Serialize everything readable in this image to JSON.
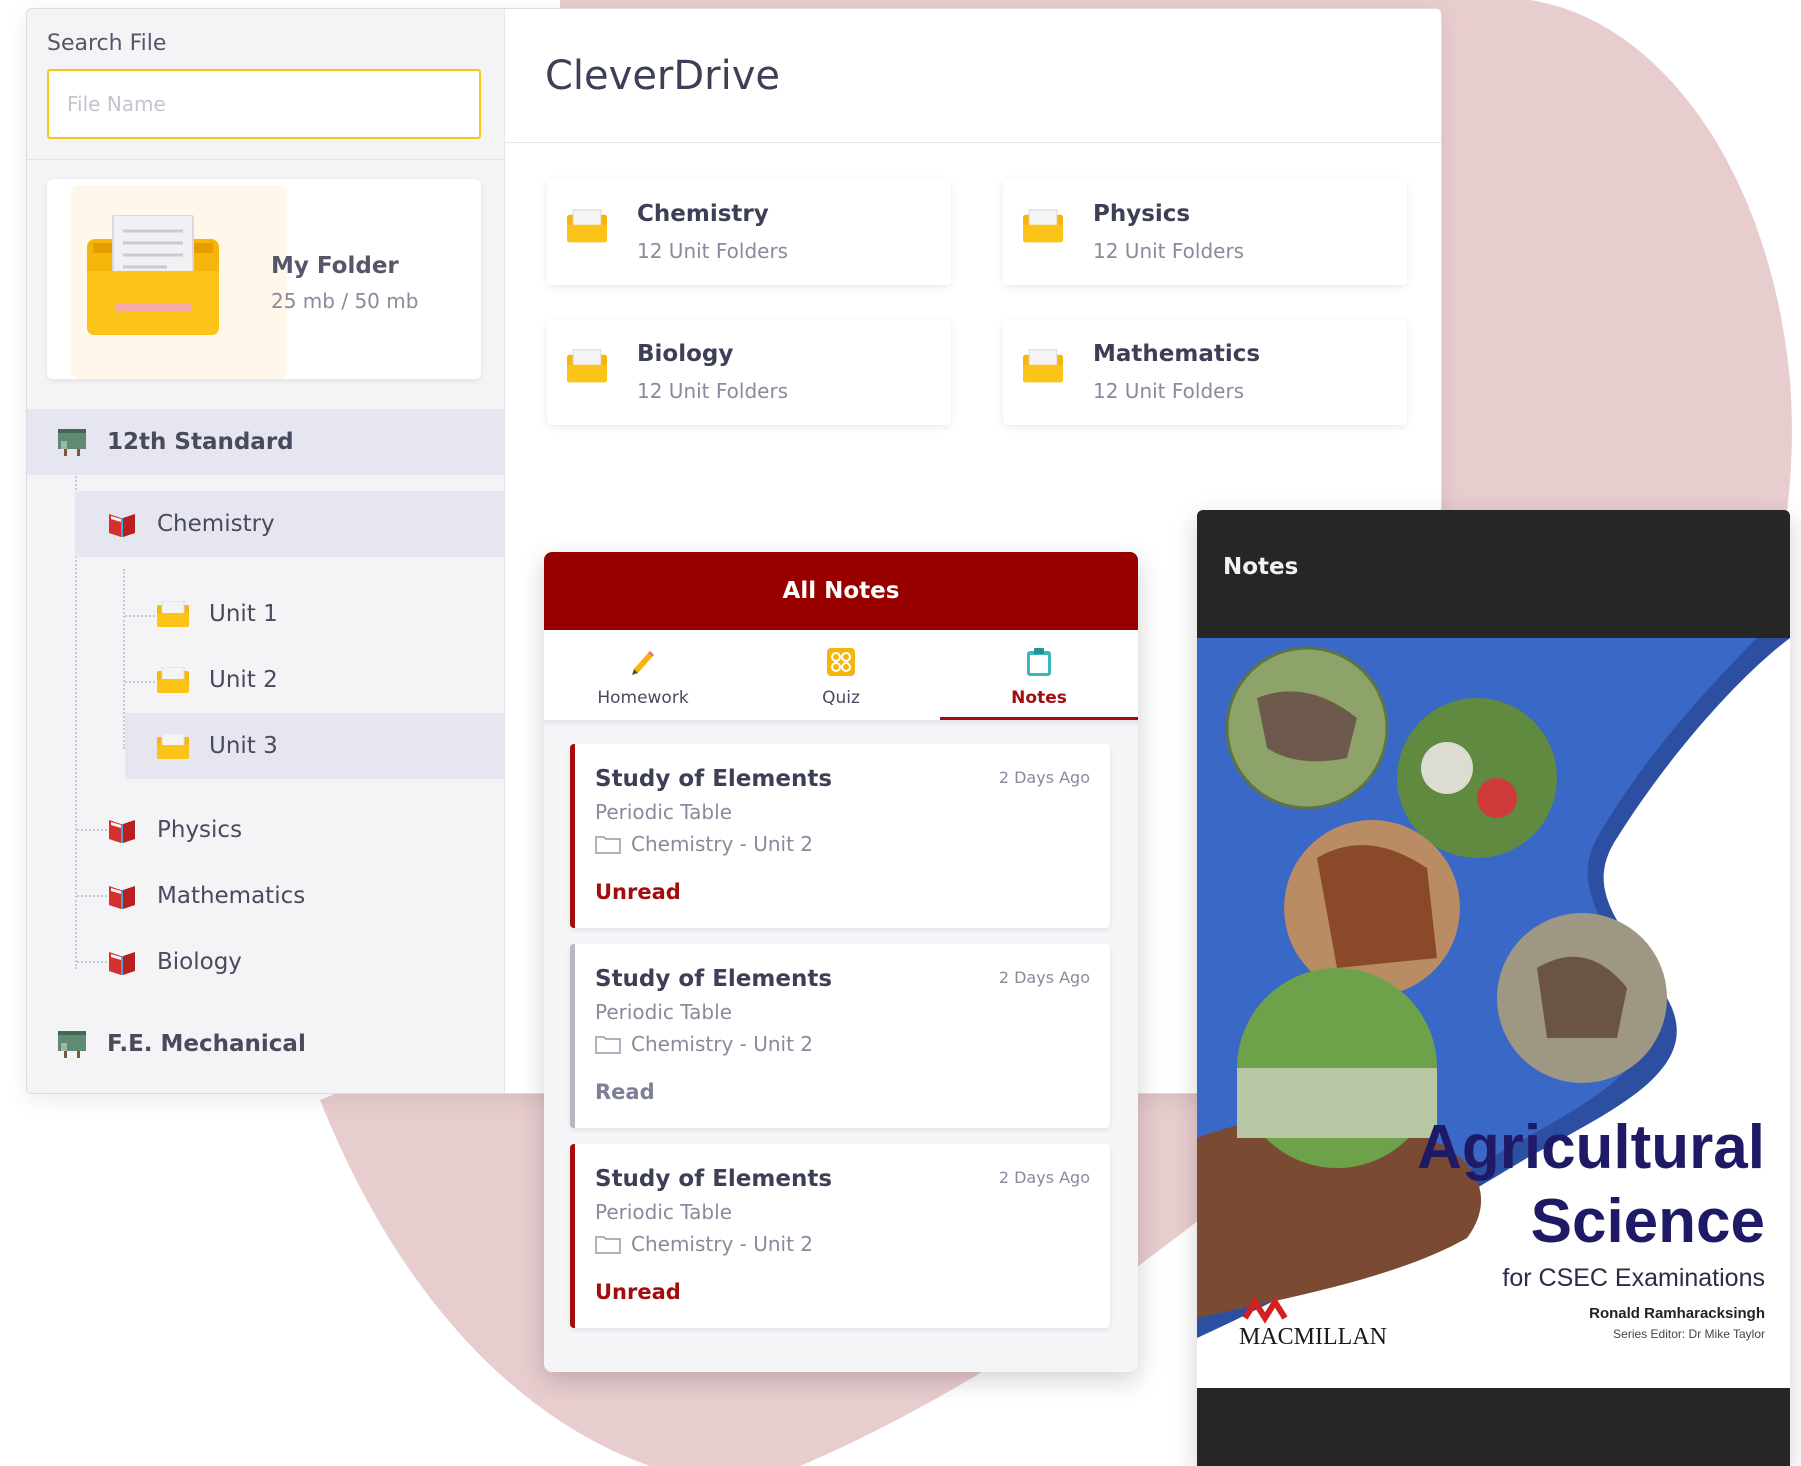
{
  "search": {
    "label": "Search File",
    "placeholder": "File Name"
  },
  "my_folder": {
    "name": "My Folder",
    "size": "25 mb / 50 mb"
  },
  "tree": {
    "standard": "12th Standard",
    "chemistry": "Chemistry",
    "units": [
      "Unit 1",
      "Unit 2",
      "Unit 3"
    ],
    "physics": "Physics",
    "mathematics": "Mathematics",
    "biology": "Biology",
    "fe_mechanical": "F.E. Mechanical"
  },
  "app": {
    "title": "CleverDrive"
  },
  "subjects": [
    {
      "name": "Chemistry",
      "sub": "12 Unit Folders"
    },
    {
      "name": "Physics",
      "sub": "12 Unit Folders"
    },
    {
      "name": "Biology",
      "sub": "12 Unit Folders"
    },
    {
      "name": "Mathematics",
      "sub": "12 Unit Folders"
    }
  ],
  "notes_panel": {
    "header": "All Notes",
    "tabs": [
      "Homework",
      "Quiz",
      "Notes"
    ],
    "active_tab": "Notes",
    "notes": [
      {
        "title": "Study of Elements",
        "time": "2 Days Ago",
        "topic": "Periodic Table",
        "path": "Chemistry - Unit 2",
        "status": "Unread"
      },
      {
        "title": "Study of Elements",
        "time": "2 Days Ago",
        "topic": "Periodic Table",
        "path": "Chemistry - Unit 2",
        "status": "Read"
      },
      {
        "title": "Study of Elements",
        "time": "2 Days Ago",
        "topic": "Periodic Table",
        "path": "Chemistry - Unit 2",
        "status": "Unread"
      }
    ]
  },
  "viewer": {
    "title": "Notes",
    "book": {
      "title_line1": "Agricultural",
      "title_line2": "Science",
      "subtitle": "for CSEC Examinations",
      "author": "Ronald Ramharacksingh",
      "editor": "Series Editor: Dr Mike Taylor",
      "publisher": "MACMILLAN"
    }
  },
  "colors": {
    "accent": "#980000",
    "folder": "#f5b50b",
    "search_border": "#f5c518",
    "blob": "#e8cdcf",
    "viewer_bg": "#262626"
  },
  "icons": {
    "folder": "folder-icon",
    "book": "book-icon",
    "standard": "blackboard-icon",
    "homework": "pencil-icon",
    "quiz": "grid-icon",
    "notes": "clipboard-icon"
  }
}
